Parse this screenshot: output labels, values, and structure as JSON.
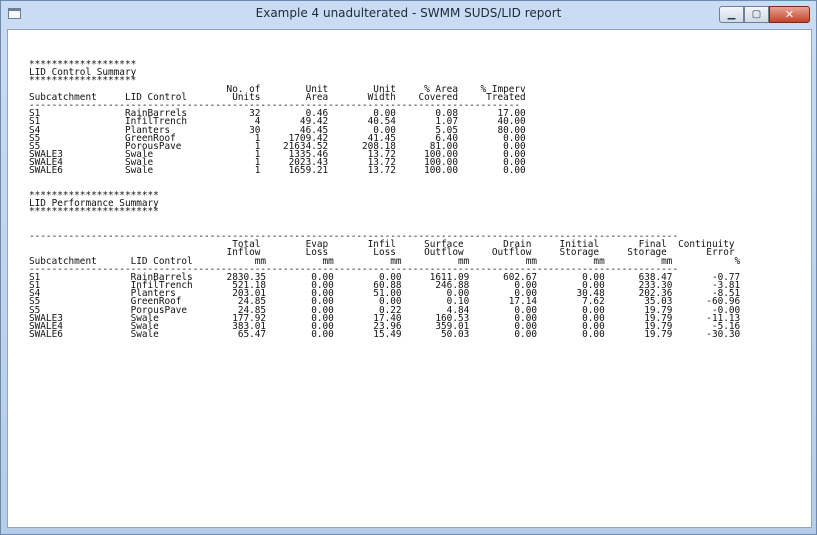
{
  "window": {
    "title": "Example 4 unadulterated - SWMM SUDS/LID report",
    "buttons": [
      "minimize",
      "maximize",
      "close"
    ]
  },
  "report": {
    "lines": [
      "*******************",
      "LID Control Summary",
      "*******************",
      "                                   No. of        Unit        Unit     % Area    % Imperv",
      "Subcatchment     LID Control        Units        Area       Width    Covered     Treated",
      "---------------------------------------------------------------------------------------",
      "S1               RainBarrels           32        0.46        0.00       0.08       17.00",
      "S1               InfilTrench            4       49.42       40.54       1.07       40.00",
      "S4               Planters              30       46.45        0.00       5.05       80.00",
      "S5               GreenRoof              1     1709.42       41.45       6.40        0.00",
      "S5               PorousPave             1    21634.52      208.18      81.00        0.00",
      "SWALE3           Swale                  1     1335.46       13.72     100.00        0.00",
      "SWALE4           Swale                  1     2023.43       13.72     100.00        0.00",
      "SWALE6           Swale                  1     1659.21       13.72     100.00        0.00",
      "",
      "",
      "***********************",
      "LID Performance Summary",
      "***********************",
      "",
      "",
      "-------------------------------------------------------------------------------------------------------------------",
      "                                    Total        Evap       Infil     Surface       Drain     Initial       Final  Continuity",
      "                                   Inflow        Loss        Loss     Outflow     Outflow     Storage     Storage       Error",
      "Subcatchment      LID Control           mm          mm          mm          mm          mm          mm          mm           %",
      "-------------------------------------------------------------------------------------------------------------------",
      "S1                RainBarrels      2830.35        0.00        0.00     1611.09      602.67        0.00      638.47       -0.77",
      "S1                InfilTrench       521.18        0.00       60.88      246.88        0.00        0.00      233.30       -3.81",
      "S4                Planters          203.01        0.00       51.00        0.00        0.00       30.48      202.36       -8.51",
      "S5                GreenRoof          24.85        0.00        0.00        0.10       17.14        7.62       35.03      -60.96",
      "S5                PorousPave         24.85        0.00        0.22        4.84        0.00        0.00       19.79       -0.00",
      "SWALE3            Swale             177.92        0.00       17.40      160.53        0.00        0.00       19.79      -11.13",
      "SWALE4            Swale             383.01        0.00       23.96      359.01        0.00        0.00       19.79       -5.16",
      "SWALE6            Swale              65.47        0.00       15.49       50.03        0.00        0.00       19.79      -30.30"
    ]
  }
}
